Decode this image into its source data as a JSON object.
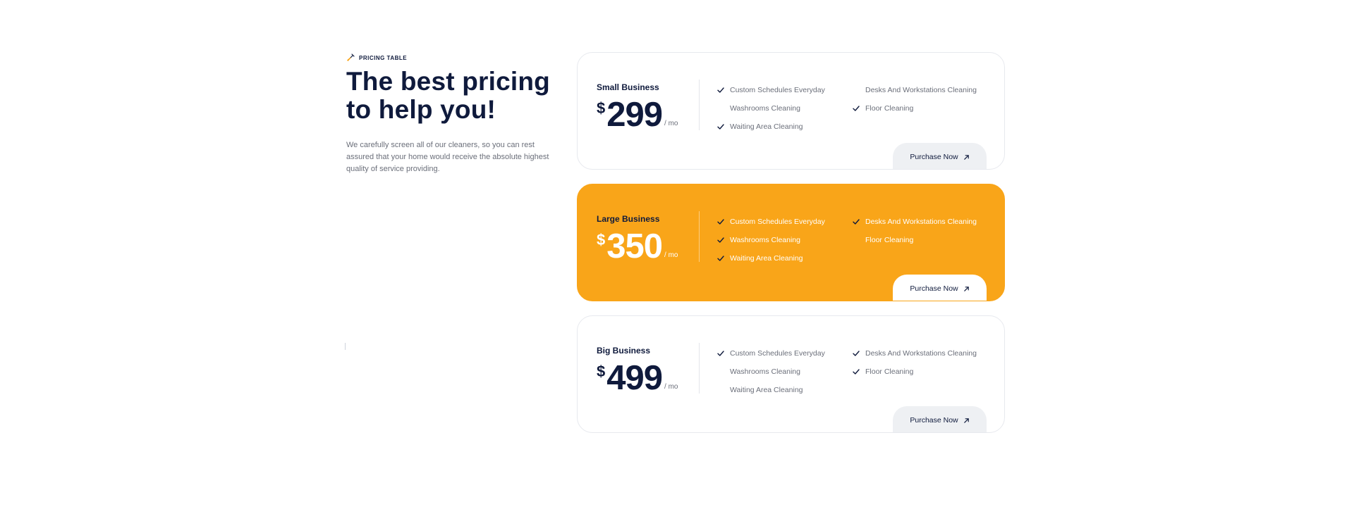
{
  "intro": {
    "eyebrow": "PRICING TABLE",
    "headline_line1": "The best pricing",
    "headline_line2": "to help you!",
    "description": "We carefully screen all of our cleaners, so you can rest assured that your home would receive the absolute highest quality of service providing."
  },
  "colors": {
    "accent": "#f9a519",
    "heading": "#0f1a3c",
    "muted": "#6b6f7a",
    "button_bg": "#eef0f3"
  },
  "plans": [
    {
      "name": "Small Business",
      "currency": "$",
      "amount": "299",
      "period": "/ mo",
      "button_label": "Purchase Now",
      "features": [
        {
          "label": "Custom Schedules Everyday",
          "included": true
        },
        {
          "label": "Washrooms Cleaning",
          "included": false
        },
        {
          "label": "Waiting Area Cleaning",
          "included": true
        },
        {
          "label": "Desks And Workstations Cleaning",
          "included": false
        },
        {
          "label": "Floor Cleaning",
          "included": true
        }
      ]
    },
    {
      "name": "Large Business",
      "currency": "$",
      "amount": "350",
      "period": "/ mo",
      "button_label": "Purchase Now",
      "features": [
        {
          "label": "Custom Schedules Everyday",
          "included": true
        },
        {
          "label": "Washrooms Cleaning",
          "included": true
        },
        {
          "label": "Waiting Area Cleaning",
          "included": true
        },
        {
          "label": "Desks And Workstations Cleaning",
          "included": true
        },
        {
          "label": "Floor Cleaning",
          "included": false
        }
      ]
    },
    {
      "name": "Big Business",
      "currency": "$",
      "amount": "499",
      "period": "/ mo",
      "button_label": "Purchase Now",
      "features": [
        {
          "label": "Custom Schedules Everyday",
          "included": true
        },
        {
          "label": "Washrooms Cleaning",
          "included": false
        },
        {
          "label": "Waiting Area Cleaning",
          "included": false
        },
        {
          "label": "Desks And Workstations Cleaning",
          "included": true
        },
        {
          "label": "Floor Cleaning",
          "included": true
        }
      ]
    }
  ]
}
